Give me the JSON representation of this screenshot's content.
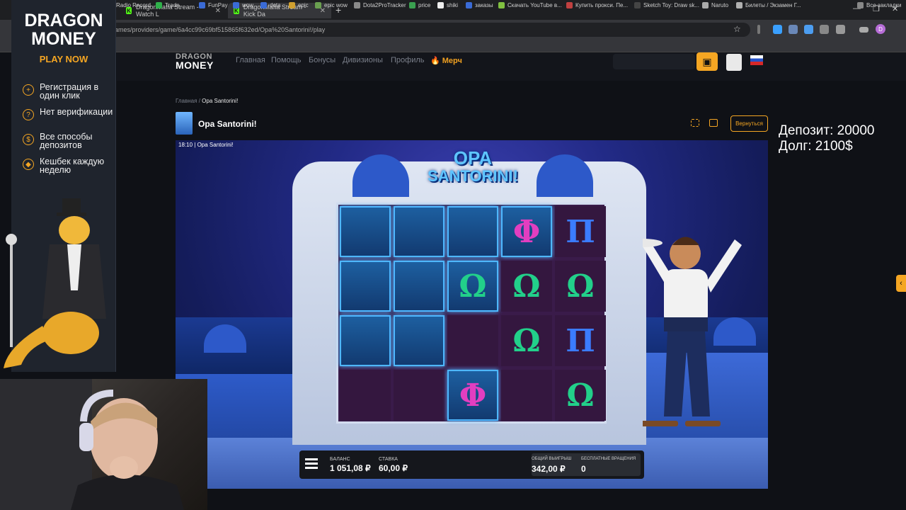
{
  "tabs": [
    {
      "label": "DragonMafia Stream - Watch L",
      "active": false
    },
    {
      "label": "DragonMafia Stream - Kick Da",
      "active": true
    }
  ],
  "address": "ames/providers/game/6a4cc99c69bf515865f632ed/Opa%20Santorini!/play",
  "bookmarks": [
    "Radio Record",
    "Trade",
    "FunPay",
    "wow",
    "dota",
    "epic",
    "epic wow",
    "Dota2ProTracker",
    "price",
    "shiki",
    "заказы",
    "Скачать YouTube в...",
    "Купить прокси. Пе...",
    "Sketch Toy: Draw sk...",
    "Naruto",
    "Билеты / Экзамен Г...",
    "Все закладки"
  ],
  "profile_initial": "D",
  "site": {
    "logo_line1": "DRAGON",
    "logo_line2": "MONEY",
    "nav": [
      "Главная",
      "Помощь",
      "Бонусы",
      "Дивизионы",
      "Профиль",
      "Мерч"
    ]
  },
  "ad": {
    "title_line1": "DRAGON",
    "title_line2": "MONEY",
    "cta": "PLAY NOW",
    "features": [
      {
        "icon": "plus-icon",
        "text": "Регистрация в один клик"
      },
      {
        "icon": "question-icon",
        "text": "Нет верификации"
      },
      {
        "icon": "coin-icon",
        "text": "Все способы депозитов"
      },
      {
        "icon": "cashback-icon",
        "text": "Кешбек каждую неделю"
      }
    ]
  },
  "breadcrumb": {
    "home": "Главная",
    "separator": "/",
    "current": "Opa Santorini!"
  },
  "game_title": "Opa Santorini!",
  "back_button": "Вернуться",
  "overlay": {
    "deposit": "Депозит: 20000",
    "debt": "Долг: 2100$"
  },
  "game": {
    "time_label": "18:10",
    "frame_title": "Opa Santorini!",
    "logo_line1": "OPA",
    "logo_line2": "SANTORINI!",
    "grid": [
      [
        "blank",
        "blank",
        "blank",
        "Φ",
        "Π"
      ],
      [
        "blank",
        "blank",
        "Ω",
        "Ω",
        "Ω"
      ],
      [
        "blank",
        "blank",
        "dark",
        "Ω",
        "Π"
      ],
      [
        "dark",
        "dark",
        "Φ",
        "dark",
        "Ω"
      ]
    ],
    "balance_label": "БАЛАНС",
    "balance_value": "1 051,08 ₽",
    "bet_label": "СТАВКА",
    "bet_value": "60,00 ₽",
    "total_win_label": "ОБЩИЙ ВЫИГРЫШ",
    "total_win_value": "342,00 ₽",
    "free_spins_label": "БЕСПЛАТНЫЕ ВРАЩЕНИЯ",
    "free_spins_value": "0"
  }
}
